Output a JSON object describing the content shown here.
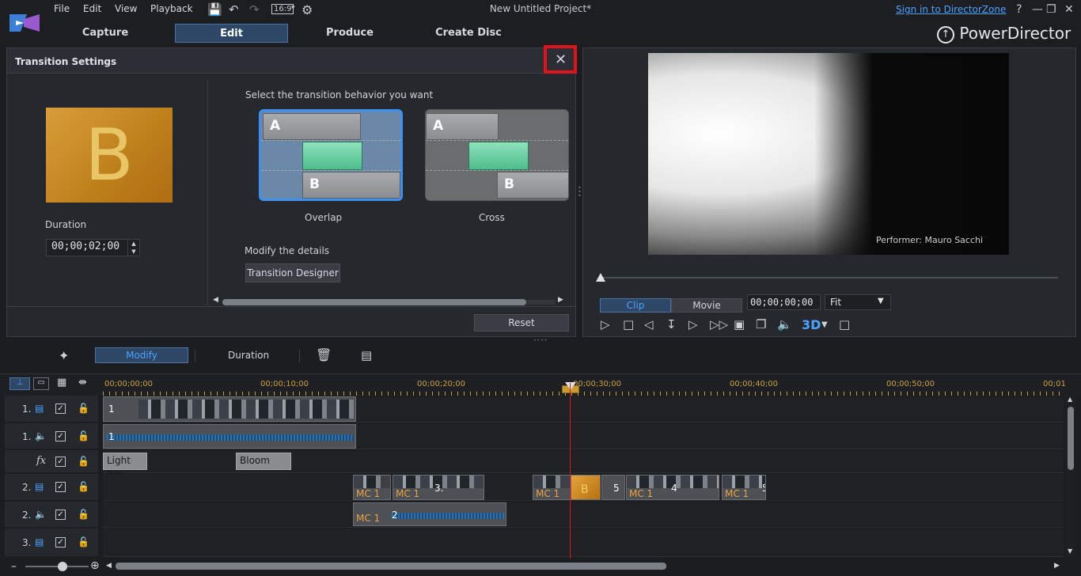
{
  "menu": {
    "file": "File",
    "edit": "Edit",
    "view": "View",
    "playback": "Playback"
  },
  "toolbar": {
    "aspect": "16:9"
  },
  "project_title": "New Untitled Project*",
  "sign_in": "Sign in to DirectorZone",
  "window": {
    "help": "?"
  },
  "modes": [
    {
      "label": "Capture"
    },
    {
      "label": "Edit"
    },
    {
      "label": "Produce"
    },
    {
      "label": "Create Disc"
    }
  ],
  "brand": "PowerDirector",
  "transition": {
    "title": "Transition Settings",
    "thumb_letter": "B",
    "duration_label": "Duration",
    "duration_value": "00;00;02;00",
    "behavior_prompt": "Select the transition behavior you want",
    "overlap": {
      "label": "Overlap",
      "a": "A",
      "b": "B"
    },
    "cross": {
      "label": "Cross",
      "a": "A",
      "b": "B"
    },
    "modify_label": "Modify the details",
    "designer_button": "Transition Designer",
    "reset_button": "Reset"
  },
  "preview": {
    "credit": "Performer: Mauro Sacchi",
    "clip_tab": "Clip",
    "movie_tab": "Movie",
    "timecode": "00;00;00;00",
    "fit": "Fit",
    "threed": "3D"
  },
  "timeline_toolbar": {
    "modify": "Modify",
    "duration": "Duration"
  },
  "ruler": [
    "00;00;00;00",
    "00;00;10;00",
    "00;00;20;00",
    "00;00;30;00",
    "00;00;40;00",
    "00;00;50;00",
    "00;01"
  ],
  "tracks": [
    {
      "num": "1."
    },
    {
      "num": "1."
    },
    {
      "num": "fx"
    },
    {
      "num": "2."
    },
    {
      "num": "2."
    },
    {
      "num": "3."
    }
  ],
  "clips": {
    "v1_label": "1",
    "a1_label": "1",
    "fx1": "Light Ray",
    "fx2": "Bloom",
    "mc": "MC 1",
    "v2_3": "3.",
    "v2_5": "5",
    "v2_4": "4",
    "v2_5b": "5",
    "a2_label": "2"
  }
}
